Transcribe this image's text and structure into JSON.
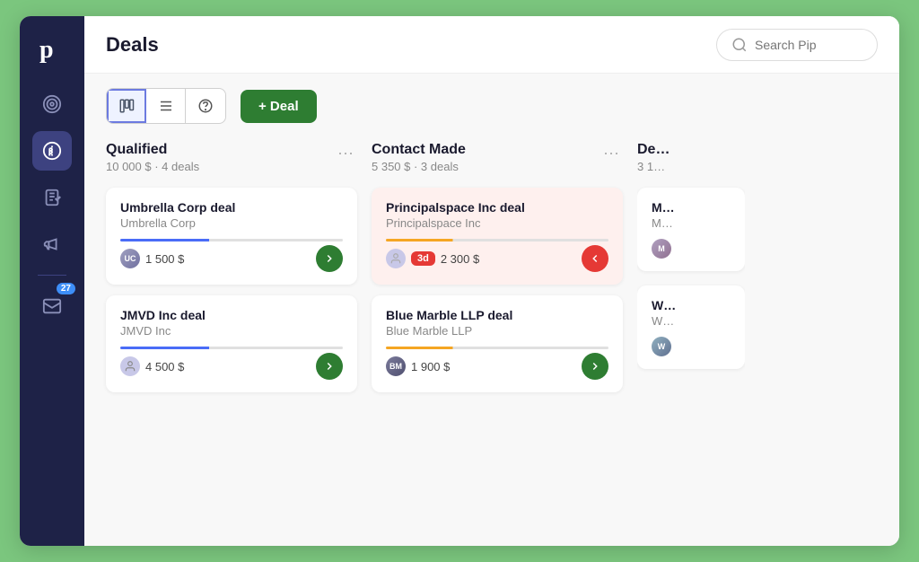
{
  "app": {
    "logo_letter": "p",
    "title": "Deals"
  },
  "search": {
    "placeholder": "Search Pip"
  },
  "sidebar": {
    "items": [
      {
        "id": "target",
        "icon": "target-icon",
        "active": false
      },
      {
        "id": "deals",
        "icon": "dollar-icon",
        "active": true
      },
      {
        "id": "tasks",
        "icon": "clipboard-icon",
        "active": false
      },
      {
        "id": "marketing",
        "icon": "megaphone-icon",
        "active": false
      },
      {
        "id": "mail",
        "icon": "mail-icon",
        "active": false
      }
    ],
    "badge_count": "27"
  },
  "toolbar": {
    "view_kanban": "Kanban view",
    "view_list": "List view",
    "view_smart": "Smart view",
    "add_deal_label": "+ Deal"
  },
  "columns": [
    {
      "id": "qualified",
      "title": "Qualified",
      "amount": "10 000 $",
      "deal_count": "4 deals",
      "deals": [
        {
          "id": "umbrella",
          "title": "Umbrella Corp deal",
          "company": "Umbrella Corp",
          "amount": "1 500 $",
          "has_avatar": true,
          "avatar_initials": "UC",
          "progress_type": "blue",
          "arrow_direction": "right",
          "highlighted": false
        },
        {
          "id": "jmvd",
          "title": "JMVD Inc deal",
          "company": "JMVD Inc",
          "amount": "4 500 $",
          "has_avatar": false,
          "avatar_initials": "",
          "progress_type": "blue",
          "arrow_direction": "right",
          "highlighted": false
        }
      ]
    },
    {
      "id": "contact-made",
      "title": "Contact Made",
      "amount": "5 350 $",
      "deal_count": "3 deals",
      "deals": [
        {
          "id": "principalspace",
          "title": "Principalspace Inc deal",
          "company": "Principalspace Inc",
          "amount": "2 300 $",
          "has_avatar": false,
          "avatar_initials": "",
          "overdue": "3d",
          "progress_type": "yellow",
          "arrow_direction": "left",
          "highlighted": true
        },
        {
          "id": "blue-marble",
          "title": "Blue Marble LLP deal",
          "company": "Blue Marble LLP",
          "amount": "1 900 $",
          "has_avatar": true,
          "avatar_initials": "BM",
          "progress_type": "yellow",
          "arrow_direction": "right",
          "highlighted": false
        }
      ]
    },
    {
      "id": "demo",
      "title": "De",
      "amount": "3 1",
      "deal_count": "",
      "deals": [
        {
          "id": "demo1",
          "title": "M",
          "company": "M",
          "amount": "",
          "has_avatar": true,
          "avatar_initials": "M",
          "progress_type": "",
          "arrow_direction": "right",
          "highlighted": false
        },
        {
          "id": "demo2",
          "title": "W",
          "company": "W",
          "amount": "",
          "has_avatar": true,
          "avatar_initials": "W",
          "progress_type": "",
          "arrow_direction": "right",
          "highlighted": false
        }
      ]
    }
  ]
}
